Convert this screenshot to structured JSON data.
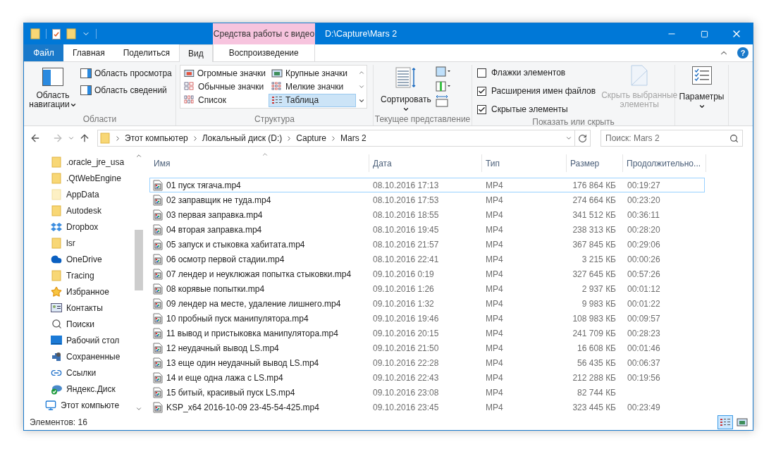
{
  "window": {
    "title": "D:\\Capture\\Mars 2",
    "context_tab_group": "Средства работы с видео"
  },
  "ribbon_tabs": [
    {
      "label": "Файл",
      "kind": "file",
      "selected": false
    },
    {
      "label": "Главная",
      "kind": "tab",
      "selected": false
    },
    {
      "label": "Поделиться",
      "kind": "tab",
      "selected": false
    },
    {
      "label": "Вид",
      "kind": "tab",
      "selected": true
    },
    {
      "label": "Воспроизведение",
      "kind": "context",
      "selected": false
    }
  ],
  "ribbon": {
    "panes": {
      "label": "Области",
      "navigation_button": [
        "Область",
        "навигации"
      ],
      "preview_pane": "Область просмотра",
      "details_pane": "Область сведений"
    },
    "layout": {
      "label": "Структура",
      "options": [
        {
          "label": "Огромные значки",
          "kind": "huge",
          "selected": false
        },
        {
          "label": "Крупные значки",
          "kind": "large",
          "selected": false
        },
        {
          "label": "Обычные значки",
          "kind": "medium",
          "selected": false
        },
        {
          "label": "Мелкие значки",
          "kind": "small",
          "selected": false
        },
        {
          "label": "Список",
          "kind": "list",
          "selected": false
        },
        {
          "label": "Таблица",
          "kind": "details",
          "selected": true
        }
      ]
    },
    "current_view": {
      "label": "Текущее представление",
      "sort_button": "Сортировать"
    },
    "show_hide": {
      "label": "Показать или скрыть",
      "checkboxes": [
        {
          "label": "Флажки элементов",
          "checked": false
        },
        {
          "label": "Расширения имен файлов",
          "checked": true
        },
        {
          "label": "Скрытые элементы",
          "checked": true
        }
      ],
      "hide_selected": {
        "label": [
          "Скрыть выбранные",
          "элементы"
        ],
        "disabled": true
      }
    },
    "options_button": "Параметры"
  },
  "help_button": "?",
  "address_bar": {
    "path": [
      "Этот компьютер",
      "Локальный диск (D:)",
      "Capture",
      "Mars 2"
    ]
  },
  "search": {
    "placeholder": "Поиск: Mars 2"
  },
  "sidebar": {
    "items": [
      {
        "label": ".oracle_jre_usa",
        "kind": "folder"
      },
      {
        "label": ".QtWebEngine",
        "kind": "folder"
      },
      {
        "label": "AppData",
        "kind": "folder-hidden"
      },
      {
        "label": "Autodesk",
        "kind": "folder"
      },
      {
        "label": "Dropbox",
        "kind": "dropbox"
      },
      {
        "label": "lsr",
        "kind": "folder"
      },
      {
        "label": "OneDrive",
        "kind": "cloud"
      },
      {
        "label": "Tracing",
        "kind": "folder"
      },
      {
        "label": "Избранное",
        "kind": "star"
      },
      {
        "label": "Контакты",
        "kind": "contacts"
      },
      {
        "label": "Поиски",
        "kind": "search"
      },
      {
        "label": "Рабочий стол",
        "kind": "desktop"
      },
      {
        "label": "Сохраненные",
        "kind": "saved"
      },
      {
        "label": "Ссылки",
        "kind": "link"
      },
      {
        "label": "Яндекс.Диск",
        "kind": "yandex"
      },
      {
        "label": "Этот компьюте",
        "kind": "computer"
      }
    ]
  },
  "table": {
    "columns": [
      "Имя",
      "Дата",
      "Тип",
      "Размер",
      "Продолжительно..."
    ],
    "rows": [
      {
        "name": "01 пуск тягача.mp4",
        "date": "08.10.2016 17:13",
        "type": "MP4",
        "size": "176 864 КБ",
        "duration": "00:19:27",
        "focused": true
      },
      {
        "name": "02 заправщик не туда.mp4",
        "date": "08.10.2016 17:53",
        "type": "MP4",
        "size": "274 664 КБ",
        "duration": "00:23:20",
        "focused": false
      },
      {
        "name": "03 первая заправка.mp4",
        "date": "08.10.2016 18:55",
        "type": "MP4",
        "size": "341 512 КБ",
        "duration": "00:36:11",
        "focused": false
      },
      {
        "name": "04 вторая заправка.mp4",
        "date": "08.10.2016 19:45",
        "type": "MP4",
        "size": "238 313 КБ",
        "duration": "00:28:20",
        "focused": false
      },
      {
        "name": "05 запуск и стыковка хабитата.mp4",
        "date": "08.10.2016 21:57",
        "type": "MP4",
        "size": "367 845 КБ",
        "duration": "00:29:06",
        "focused": false
      },
      {
        "name": "06 осмотр первой стадии.mp4",
        "date": "08.10.2016 22:41",
        "type": "MP4",
        "size": "3 215 КБ",
        "duration": "00:00:26",
        "focused": false
      },
      {
        "name": "07 лендер и неуклюжая попытка стыковки.mp4",
        "date": "09.10.2016 0:19",
        "type": "MP4",
        "size": "327 645 КБ",
        "duration": "00:57:26",
        "focused": false
      },
      {
        "name": "08 корявые попытки.mp4",
        "date": "09.10.2016 1:26",
        "type": "MP4",
        "size": "2 937 КБ",
        "duration": "00:01:12",
        "focused": false
      },
      {
        "name": "09 лендер на месте, удаление лишнего.mp4",
        "date": "09.10.2016 1:32",
        "type": "MP4",
        "size": "9 983 КБ",
        "duration": "00:01:22",
        "focused": false
      },
      {
        "name": "10 пробный пуск манипулятора.mp4",
        "date": "09.10.2016 19:46",
        "type": "MP4",
        "size": "108 983 КБ",
        "duration": "00:09:57",
        "focused": false
      },
      {
        "name": "11 вывод и пристыковка манипулятора.mp4",
        "date": "09.10.2016 20:15",
        "type": "MP4",
        "size": "241 709 КБ",
        "duration": "00:28:23",
        "focused": false
      },
      {
        "name": "12 неудачный вывод LS.mp4",
        "date": "09.10.2016 21:50",
        "type": "MP4",
        "size": "16 608 КБ",
        "duration": "00:01:46",
        "focused": false
      },
      {
        "name": "13 еще один неудачный вывод LS.mp4",
        "date": "09.10.2016 22:28",
        "type": "MP4",
        "size": "56 435 КБ",
        "duration": "00:06:37",
        "focused": false
      },
      {
        "name": "14 и еще одна лажа с LS.mp4",
        "date": "09.10.2016 22:43",
        "type": "MP4",
        "size": "212 288 КБ",
        "duration": "00:19:56",
        "focused": false
      },
      {
        "name": "15 битый, красивый пуск LS.mp4",
        "date": "09.10.2016 23:08",
        "type": "MP4",
        "size": "82 744 КБ",
        "focused": false
      },
      {
        "name": "KSP_x64 2016-10-09 23-45-54-425.mp4",
        "date": "09.10.2016 23:45",
        "type": "MP4",
        "size": "323 445 КБ",
        "duration": "00:23:49",
        "focused": false
      }
    ]
  },
  "status_bar": {
    "item_count": "Элементов: 16",
    "view_buttons": [
      {
        "kind": "details",
        "selected": true
      },
      {
        "kind": "thumbnails",
        "selected": false
      }
    ]
  }
}
